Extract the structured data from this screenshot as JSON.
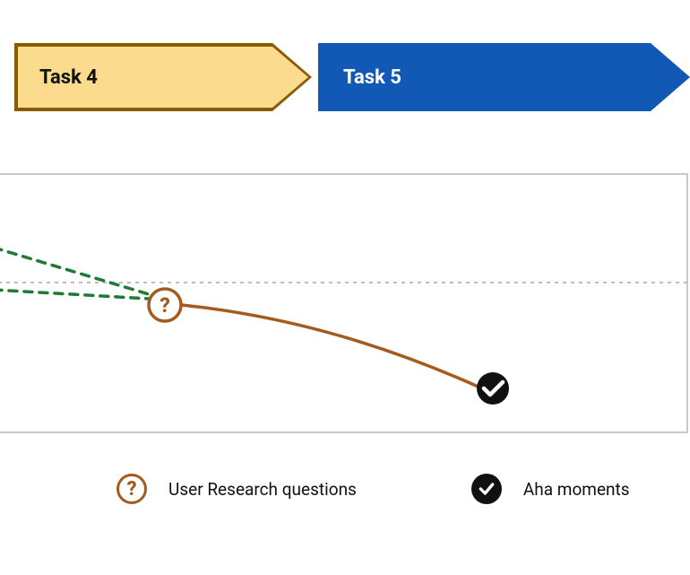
{
  "arrows": {
    "task4": {
      "label": "Task 4"
    },
    "task5": {
      "label": "Task 5"
    }
  },
  "legend": {
    "research": "User Research questions",
    "aha": "Aha moments"
  },
  "icons": {
    "question_glyph": "?"
  },
  "colors": {
    "task4_fill": "#fbdc8e",
    "task4_stroke": "#8a5a00",
    "task5_fill": "#1259b5",
    "curve": "#a65b1e",
    "green_dash": "#1f7a32",
    "grid_dash": "#bdbdbd",
    "box_border": "#c8c8c8",
    "black": "#111111"
  },
  "chart_data": {
    "type": "line",
    "title": "",
    "xlabel": "",
    "ylabel": "",
    "xlim": [
      0,
      770
    ],
    "ylim": [
      0,
      290
    ],
    "grid_y": [
      122
    ],
    "series": [
      {
        "name": "emotion-curve",
        "style": "solid",
        "color": "#a65b1e",
        "points": [
          [
            205,
            147
          ],
          [
            360,
            175
          ],
          [
            470,
            210
          ],
          [
            540,
            240
          ]
        ]
      },
      {
        "name": "green-dash-upper",
        "style": "dashed",
        "color": "#1f7a32",
        "points": [
          [
            -5,
            83
          ],
          [
            168,
            135
          ]
        ]
      },
      {
        "name": "green-dash-lower",
        "style": "dashed",
        "color": "#1f7a32",
        "points": [
          [
            -5,
            130
          ],
          [
            168,
            140
          ]
        ]
      }
    ],
    "markers": [
      {
        "kind": "question",
        "x": 186,
        "y": 147
      },
      {
        "kind": "check",
        "x": 552,
        "y": 240
      }
    ]
  }
}
